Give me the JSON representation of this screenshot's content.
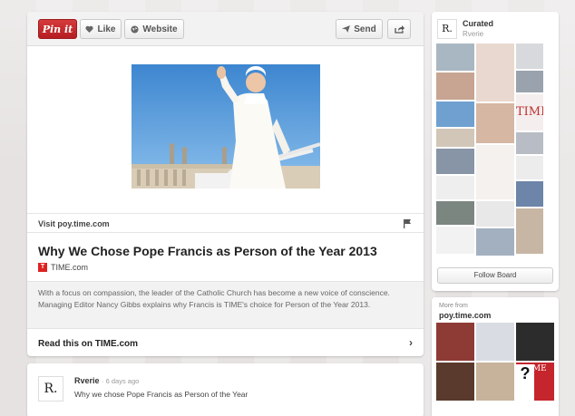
{
  "toolbar": {
    "pinit_label": "Pin it",
    "like_label": "Like",
    "website_label": "Website",
    "send_label": "Send"
  },
  "pin": {
    "visit_label": "Visit poy.time.com",
    "title": "Why We Chose Pope Francis as Person of the Year 2013",
    "source_name": "TIME.com",
    "description": "With a focus on compassion, the leader of the Catholic Church has become a new voice of conscience. Managing Editor Nancy Gibbs explains why Francis is TIME's choice for Person of the Year 2013.",
    "read_label": "Read this on TIME.com"
  },
  "comment": {
    "user": "Rverie",
    "time": "· 6 days ago",
    "text": "Why we chose Pope Francis as Person of the Year"
  },
  "board": {
    "name": "Curated",
    "owner": "Rverie",
    "follow_label": "Follow Board"
  },
  "more": {
    "label": "More from",
    "site": "poy.time.com"
  },
  "avatar_letter": "R.",
  "colors": {
    "pinit_red": "#c92228",
    "sky_blue": "#4a90d4"
  }
}
